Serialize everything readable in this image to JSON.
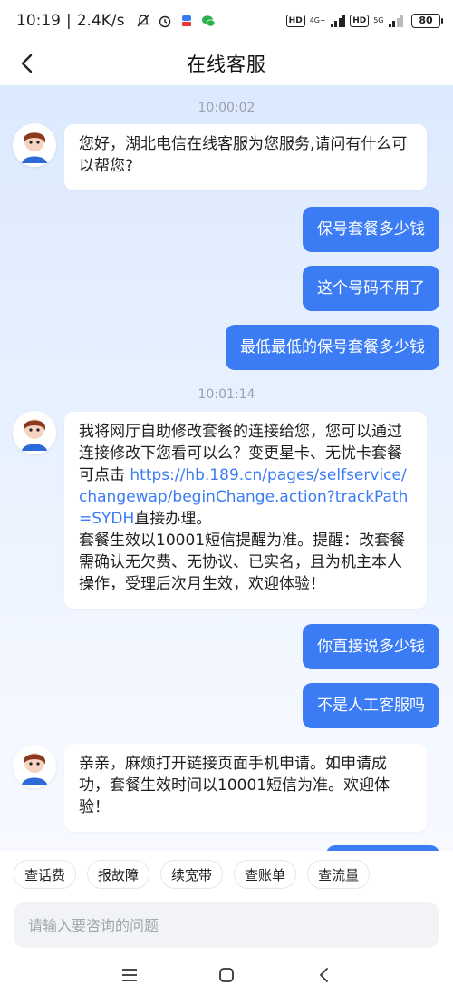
{
  "status_bar": {
    "time": "10:19",
    "network_speed": "2.4K/s",
    "sim1_tag": "4G+",
    "sim2_tag": "5G",
    "hd_label": "HD",
    "battery": "80"
  },
  "header": {
    "title": "在线客服",
    "back_icon": "chevron-left-icon"
  },
  "chat": {
    "messages": [
      {
        "type": "timestamp",
        "text": "10:00:02"
      },
      {
        "type": "bot",
        "text": "您好，湖北电信在线客服为您服务,请问有什么可以帮您?"
      },
      {
        "type": "user",
        "text": "保号套餐多少钱"
      },
      {
        "type": "user",
        "text": "这个号码不用了"
      },
      {
        "type": "user",
        "text": "最低最低的保号套餐多少钱"
      },
      {
        "type": "timestamp",
        "text": "10:01:14"
      },
      {
        "type": "bot",
        "text_before": "我将网厅自助修改套餐的连接给您，您可以通过连接修改下您看可以么？变更星卡、无忧卡套餐可点击 ",
        "link": "https://hb.189.cn/pages/selfservice/changewap/beginChange.action?trackPath=SYDH",
        "text_after": "直接办理。",
        "text_2": "套餐生效以10001短信提醒为准。提醒：改套餐需确认无欠费、无协议、已实名，且为机主本人操作，受理后次月生效，欢迎体验！"
      },
      {
        "type": "user",
        "text": "你直接说多少钱"
      },
      {
        "type": "user",
        "text": "不是人工客服吗"
      },
      {
        "type": "bot",
        "text": "亲亲，麻烦打开链接页面手机申请。如申请成功，套餐生效时间以10001短信为准。欢迎体验！"
      }
    ]
  },
  "quick_replies": [
    "查话费",
    "报故障",
    "续宽带",
    "查账单",
    "查流量"
  ],
  "input": {
    "placeholder": "请输入要咨询的问题",
    "value": ""
  },
  "nav": {
    "menu_icon": "menu-icon",
    "home_icon": "home-icon",
    "back_icon": "back-icon"
  },
  "colors": {
    "accent": "#3b7cf5",
    "user_bubble": "#3b7cf5",
    "chat_bg": "#dceafe"
  }
}
